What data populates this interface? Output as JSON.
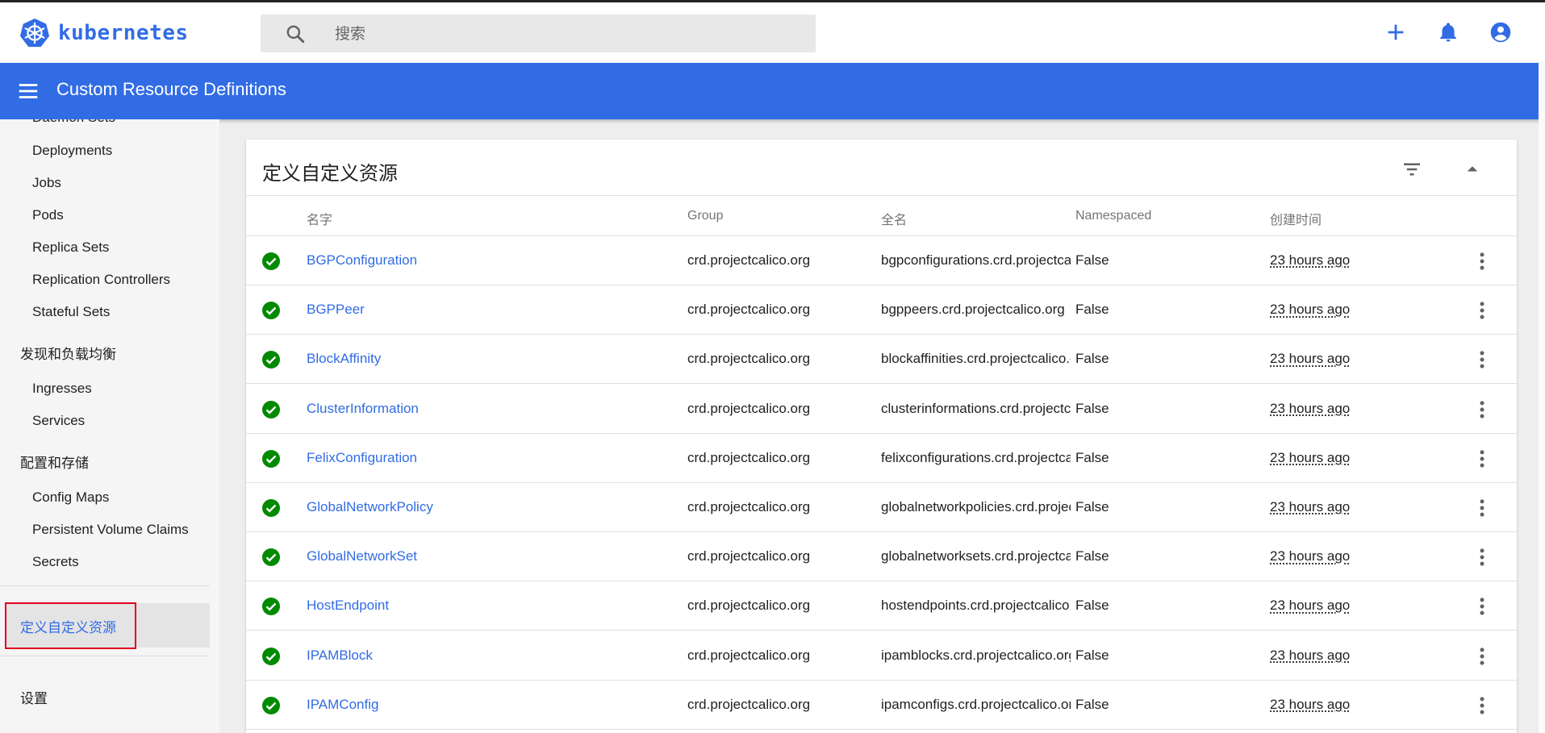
{
  "app": {
    "logo_text": "kubernetes",
    "brand_color": "#326ce5"
  },
  "search": {
    "placeholder": "搜索",
    "value": ""
  },
  "top_actions": {
    "icons": [
      "add-icon",
      "notifications-icon",
      "account-icon"
    ]
  },
  "toolbar": {
    "title": "Custom Resource Definitions"
  },
  "sidebar": {
    "items": [
      {
        "label": "Daemon Sets"
      },
      {
        "label": "Deployments"
      },
      {
        "label": "Jobs"
      },
      {
        "label": "Pods"
      },
      {
        "label": "Replica Sets"
      },
      {
        "label": "Replication Controllers"
      },
      {
        "label": "Stateful Sets"
      },
      {
        "label": "发现和负载均衡"
      },
      {
        "label": "Ingresses"
      },
      {
        "label": "Services"
      },
      {
        "label": "配置和存储"
      },
      {
        "label": "Config Maps"
      },
      {
        "label": "Persistent Volume Claims"
      },
      {
        "label": "Secrets"
      },
      {
        "label": "定义自定义资源",
        "active": true
      },
      {
        "label": "设置"
      }
    ]
  },
  "card": {
    "title": "定义自定义资源",
    "columns": [
      "名字",
      "Group",
      "全名",
      "Namespaced",
      "创建时间"
    ],
    "rows": [
      {
        "name": "BGPConfiguration",
        "group": "crd.projectcalico.org",
        "fullname": "bgpconfigurations.crd.projectcalico.org",
        "namespaced": "False",
        "created": "23 hours ago"
      },
      {
        "name": "BGPPeer",
        "group": "crd.projectcalico.org",
        "fullname": "bgppeers.crd.projectcalico.org",
        "namespaced": "False",
        "created": "23 hours ago"
      },
      {
        "name": "BlockAffinity",
        "group": "crd.projectcalico.org",
        "fullname": "blockaffinities.crd.projectcalico.org",
        "namespaced": "False",
        "created": "23 hours ago"
      },
      {
        "name": "ClusterInformation",
        "group": "crd.projectcalico.org",
        "fullname": "clusterinformations.crd.projectcalico.org",
        "namespaced": "False",
        "created": "23 hours ago"
      },
      {
        "name": "FelixConfiguration",
        "group": "crd.projectcalico.org",
        "fullname": "felixconfigurations.crd.projectcalico.org",
        "namespaced": "False",
        "created": "23 hours ago"
      },
      {
        "name": "GlobalNetworkPolicy",
        "group": "crd.projectcalico.org",
        "fullname": "globalnetworkpolicies.crd.projectcalico.org",
        "namespaced": "False",
        "created": "23 hours ago"
      },
      {
        "name": "GlobalNetworkSet",
        "group": "crd.projectcalico.org",
        "fullname": "globalnetworksets.crd.projectcalico.org",
        "namespaced": "False",
        "created": "23 hours ago"
      },
      {
        "name": "HostEndpoint",
        "group": "crd.projectcalico.org",
        "fullname": "hostendpoints.crd.projectcalico.org",
        "namespaced": "False",
        "created": "23 hours ago"
      },
      {
        "name": "IPAMBlock",
        "group": "crd.projectcalico.org",
        "fullname": "ipamblocks.crd.projectcalico.org",
        "namespaced": "False",
        "created": "23 hours ago"
      },
      {
        "name": "IPAMConfig",
        "group": "crd.projectcalico.org",
        "fullname": "ipamconfigs.crd.projectcalico.org",
        "namespaced": "False",
        "created": "23 hours ago"
      }
    ],
    "status_color": "#008a00"
  }
}
